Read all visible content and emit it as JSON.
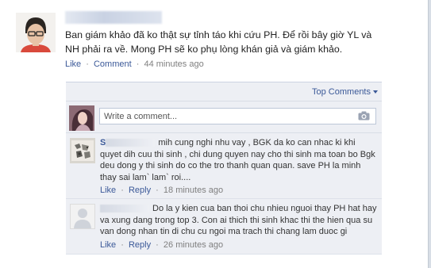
{
  "post": {
    "author": "",
    "text": "Ban giám khảo đã ko thật sự tỉnh táo khi cứu PH. Để rồi bây giờ YL và NH phải ra về. Mong PH sẽ ko phụ lòng khán giả và giám khảo.",
    "like_label": "Like",
    "separator": "·",
    "comment_label": "Comment",
    "timestamp": "44 minutes ago"
  },
  "comments_panel": {
    "sort_label": "Top Comments",
    "write_placeholder": "Write a comment...",
    "items": [
      {
        "author": "S",
        "text": "mih cung nghi nhu vay , BGK da ko can nhac ki khi quyet dih cuu thi sinh , chi dung quyen nay cho thi sinh ma toan bo Bgk deu dong y thi sinh do co the tro thanh quan quan. save PH la minh thay sai lam` lam` roi....",
        "like_label": "Like",
        "reply_label": "Reply",
        "timestamp": "18 minutes ago"
      },
      {
        "author": "",
        "text": "Do la y kien cua ban thoi chu nhieu nguoi thay PH hat hay va xung dang trong top 3. Con ai thich thi sinh khac thi the hien qua su van dong nhan tin di chu cu ngoi ma trach thi chang lam duoc gi",
        "like_label": "Like",
        "reply_label": "Reply",
        "timestamp": "26 minutes ago"
      }
    ]
  },
  "colors": {
    "link": "#3b5998",
    "panel_bg": "#edeff4",
    "meta_gray": "#7f7f7f"
  },
  "icons": {
    "camera": "camera-icon",
    "caret": "caret-down-icon"
  }
}
